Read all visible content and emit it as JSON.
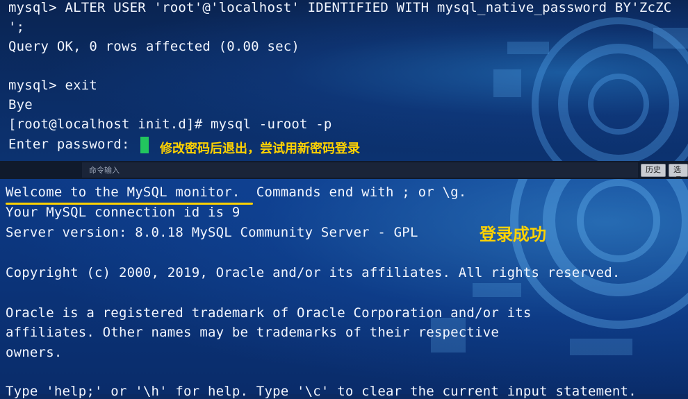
{
  "terminal_top": {
    "lines": [
      "mysql> ALTER USER 'root'@'localhost' IDENTIFIED WITH mysql_native_password BY'ZcZC",
      "';",
      "Query OK, 0 rows affected (0.00 sec)",
      "",
      "mysql> exit",
      "Bye",
      "[root@localhost init.d]# mysql -uroot -p",
      "Enter password:"
    ],
    "annotation": "修改密码后退出，尝试用新密码登录"
  },
  "command_bar": {
    "placeholder": "命令输入",
    "history_button": "历史",
    "options_button": "选项"
  },
  "terminal_bottom": {
    "lines": [
      "Welcome to the MySQL monitor.  Commands end with ; or \\g.",
      "Your MySQL connection id is 9",
      "Server version: 8.0.18 MySQL Community Server - GPL",
      "",
      "Copyright (c) 2000, 2019, Oracle and/or its affiliates. All rights reserved.",
      "",
      "Oracle is a registered trademark of Oracle Corporation and/or its",
      "affiliates. Other names may be trademarks of their respective",
      "owners.",
      "",
      "Type 'help;' or '\\h' for help. Type '\\c' to clear the current input statement."
    ],
    "annotation": "登录成功"
  },
  "colors": {
    "annotation": "#ffd200",
    "cursor": "#22c55e",
    "text": "#f2f6ff"
  }
}
